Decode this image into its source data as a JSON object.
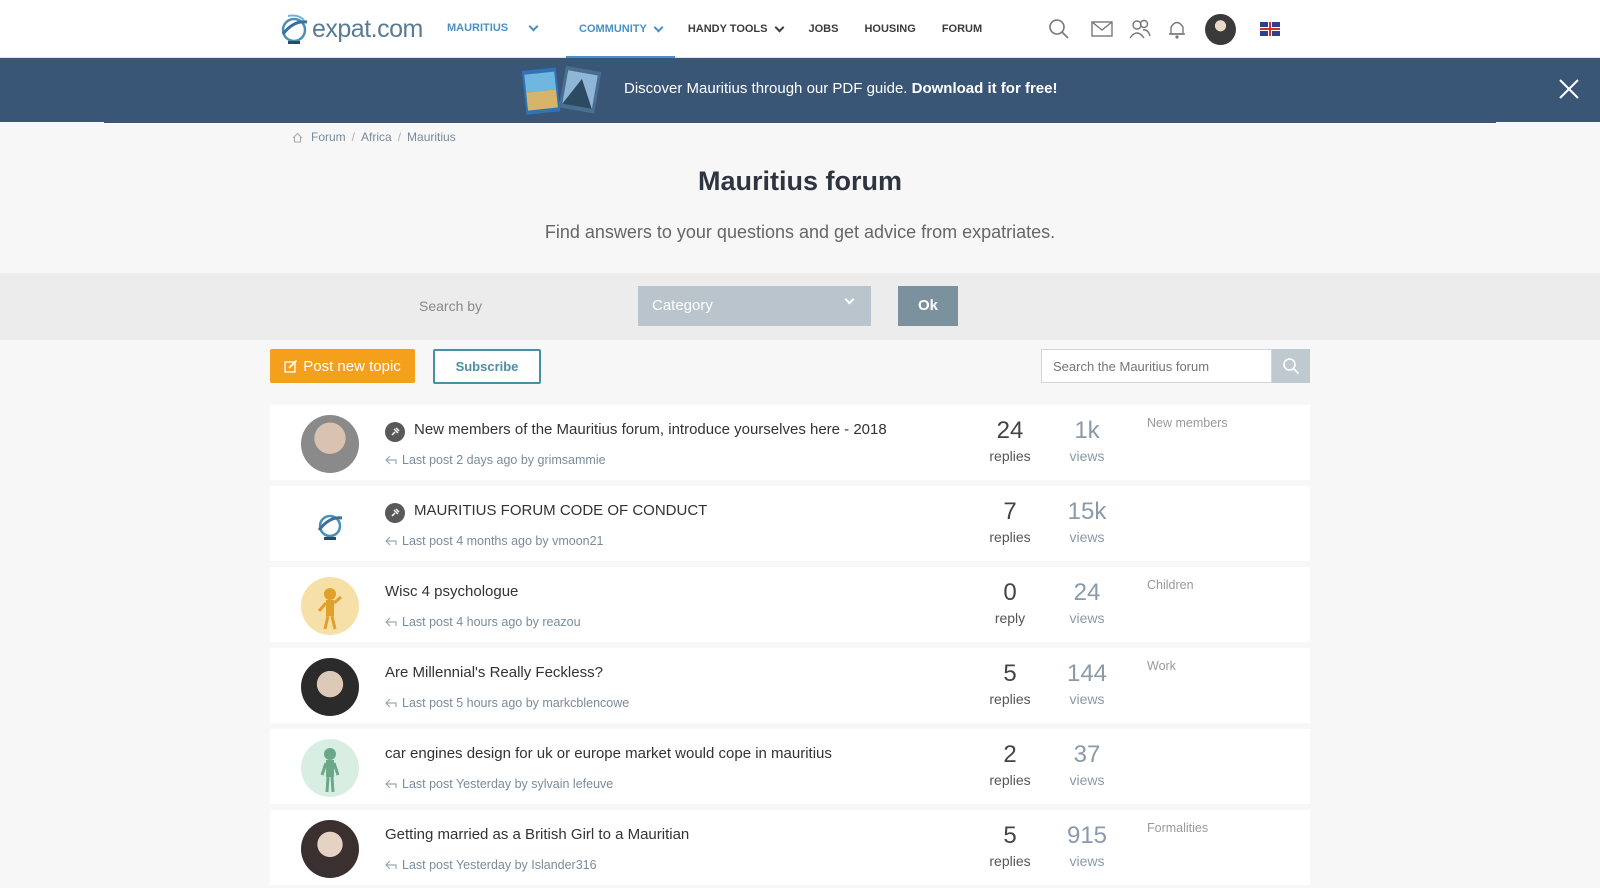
{
  "header": {
    "logo_text": "expat.com",
    "country": "MAURITIUS",
    "nav": [
      "COMMUNITY",
      "HANDY TOOLS",
      "JOBS",
      "HOUSING",
      "FORUM"
    ],
    "accent": "#4a90c2"
  },
  "banner": {
    "text": "Discover Mauritius through our PDF guide.",
    "cta": "Download it for free!",
    "bg": "#3a5676"
  },
  "breadcrumb": [
    "Forum",
    "Africa",
    "Mauritius"
  ],
  "page": {
    "title": "Mauritius forum",
    "subtitle": "Find answers to your questions and get advice from expatriates."
  },
  "search": {
    "label": "Search by",
    "select_value": "Category",
    "ok_label": "Ok",
    "forum_placeholder": "Search the Mauritius forum"
  },
  "actions": {
    "post_label": "Post new topic",
    "subscribe_label": "Subscribe",
    "post_color": "#f4a01c"
  },
  "topics": [
    {
      "pinned": true,
      "title": "New members of the Mauritius forum, introduce yourselves here - 2018",
      "last_post": "Last post 2 days ago by grimsammie",
      "replies": "24",
      "replies_label": "replies",
      "views": "1k",
      "views_label": "views",
      "category": "New members"
    },
    {
      "pinned": true,
      "title": "MAURITIUS FORUM CODE OF CONDUCT",
      "last_post": "Last post 4 months ago by vmoon21",
      "replies": "7",
      "replies_label": "replies",
      "views": "15k",
      "views_label": "views",
      "category": ""
    },
    {
      "pinned": false,
      "title": "Wisc 4 psychologue",
      "last_post": "Last post 4 hours ago by reazou",
      "replies": "0",
      "replies_label": "reply",
      "views": "24",
      "views_label": "views",
      "category": "Children"
    },
    {
      "pinned": false,
      "title": "Are Millennial's Really Feckless?",
      "last_post": "Last post 5 hours ago by markcblencowe",
      "replies": "5",
      "replies_label": "replies",
      "views": "144",
      "views_label": "views",
      "category": "Work"
    },
    {
      "pinned": false,
      "title": "car engines design for uk or europe market would cope in mauritius",
      "last_post": "Last post Yesterday by sylvain lefeuve",
      "replies": "2",
      "replies_label": "replies",
      "views": "37",
      "views_label": "views",
      "category": ""
    },
    {
      "pinned": false,
      "title": "Getting married as a British Girl to a Mauritian",
      "last_post": "Last post Yesterday by Islander316",
      "replies": "5",
      "replies_label": "replies",
      "views": "915",
      "views_label": "views",
      "category": "Formalities"
    }
  ]
}
